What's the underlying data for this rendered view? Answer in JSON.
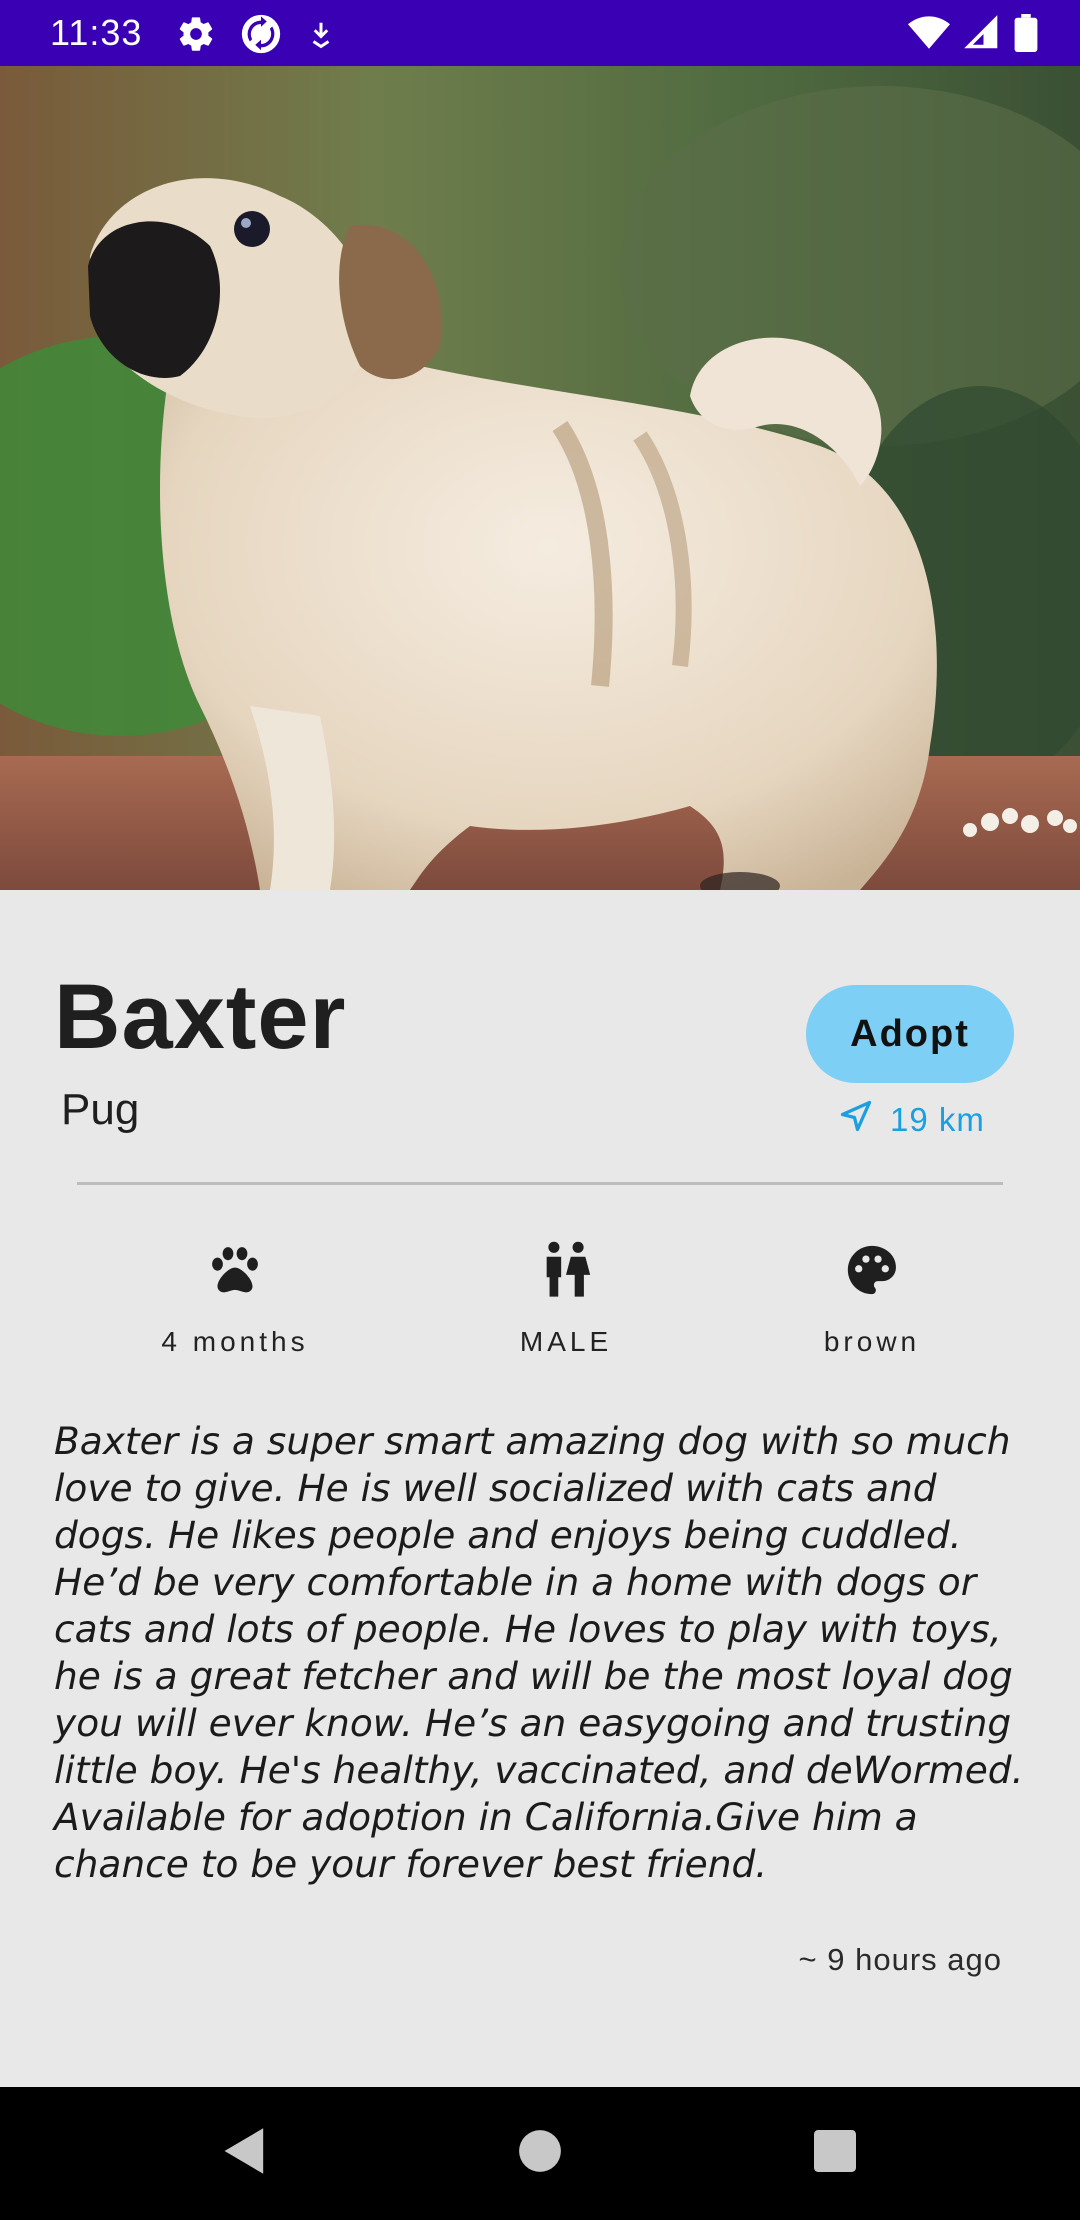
{
  "status_bar": {
    "time": "11:33",
    "left_icons": [
      "gear-icon",
      "sync-icon",
      "download-arrow-icon"
    ],
    "right_icons": [
      "wifi-icon",
      "cell-signal-icon",
      "battery-icon"
    ],
    "background_color": "#3a00b3"
  },
  "pet": {
    "name": "Baxter",
    "breed": "Pug",
    "adopt_label": "Adopt",
    "distance": "19 km",
    "attributes": [
      {
        "icon": "paw-icon",
        "label": "4 months"
      },
      {
        "icon": "gender-icon",
        "label": "MALE"
      },
      {
        "icon": "palette-icon",
        "label": "brown"
      }
    ],
    "description": "Baxter is a super smart amazing dog with so much love to give. He is well socialized with cats and dogs. He likes people and enjoys being cuddled. He’d be very comfortable in a home with dogs or cats and lots of people. He loves to play with toys, he is a great fetcher and will be the most loyal dog you will ever know. He’s an easygoing and trusting little boy. He's healthy, vaccinated, and deWormed. Available for adoption in California.Give him a chance to be your forever best friend.",
    "posted": "~ 9 hours ago"
  },
  "colors": {
    "accent": "#7dcff5",
    "distance_text": "#1aa0e0",
    "background": "#e8e8e8"
  },
  "nav_bar": {
    "buttons": [
      "back-icon",
      "home-icon",
      "recents-icon"
    ]
  }
}
